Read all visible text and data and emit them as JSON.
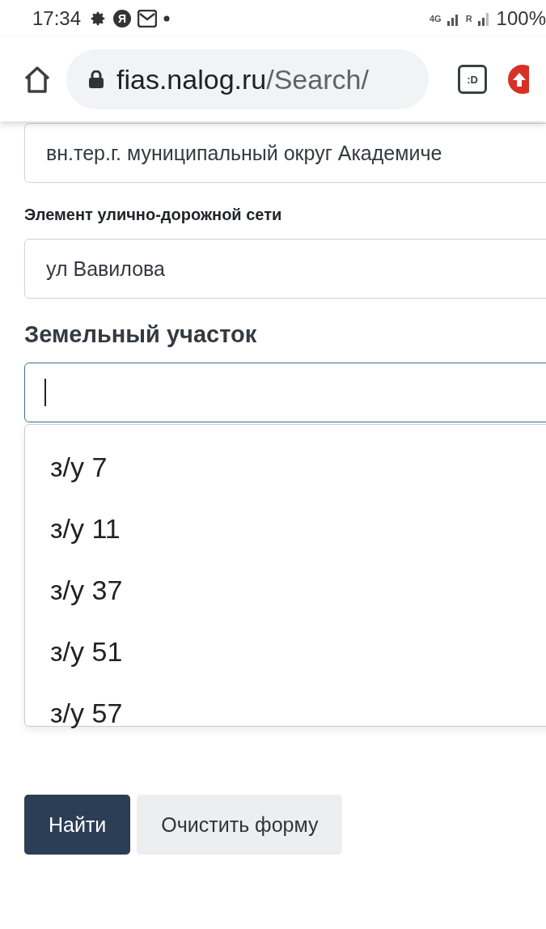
{
  "status_bar": {
    "time": "17:34",
    "notification_letter": "Я",
    "network_label": "4G",
    "roaming_label": "R",
    "battery": "100%"
  },
  "browser": {
    "url_host": "fias.nalog.ru",
    "url_path": "/Search/",
    "tab_switcher_label": ":D"
  },
  "form": {
    "fields": [
      {
        "value": "вн.тер.г. муниципальный округ Академиче"
      },
      {
        "label": "Элемент улично-дорожной сети",
        "value": "ул Вавилова"
      }
    ],
    "land_plot": {
      "heading": "Земельный участок",
      "focused": true,
      "options": [
        "з/у 7",
        "з/у 11",
        "з/у 37",
        "з/у 51",
        "з/у 57"
      ]
    },
    "buttons": [
      {
        "label": "Найти",
        "kind": "primary"
      },
      {
        "label": "Очистить форму",
        "kind": "secondary"
      }
    ]
  }
}
